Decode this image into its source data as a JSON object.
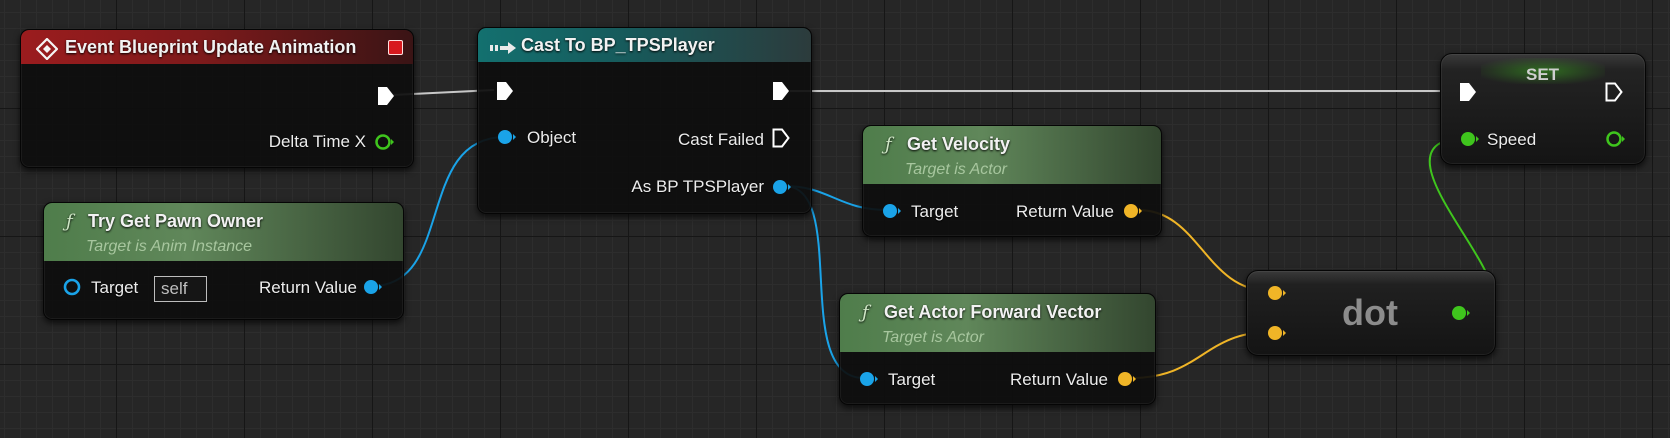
{
  "colors": {
    "exec": "#ffffff",
    "object_wire": "#1aa3e8",
    "vector_wire": "#f0b527",
    "float_wire": "#3fc51d",
    "exec_wire": "#c8c8c8"
  },
  "nodes": {
    "event": {
      "icon": "event-diamond-icon",
      "title": "Event Blueprint Update Animation",
      "delta_label": "Delta Time X"
    },
    "try_get_pawn": {
      "icon": "function-icon",
      "title": "Try Get Pawn Owner",
      "subtitle": "Target is Anim Instance",
      "target_label": "Target",
      "target_value": "self",
      "return_label": "Return Value"
    },
    "cast": {
      "icon": "cast-arrow-icon",
      "title": "Cast To BP_TPSPlayer",
      "object_label": "Object",
      "cast_failed_label": "Cast Failed",
      "as_label": "As BP TPSPlayer"
    },
    "get_velocity": {
      "icon": "function-icon",
      "title": "Get Velocity",
      "subtitle": "Target is Actor",
      "target_label": "Target",
      "return_label": "Return Value"
    },
    "get_forward": {
      "icon": "function-icon",
      "title": "Get Actor Forward Vector",
      "subtitle": "Target is Actor",
      "target_label": "Target",
      "return_label": "Return Value"
    },
    "dot": {
      "label": "dot"
    },
    "set": {
      "title": "SET",
      "speed_label": "Speed"
    }
  }
}
